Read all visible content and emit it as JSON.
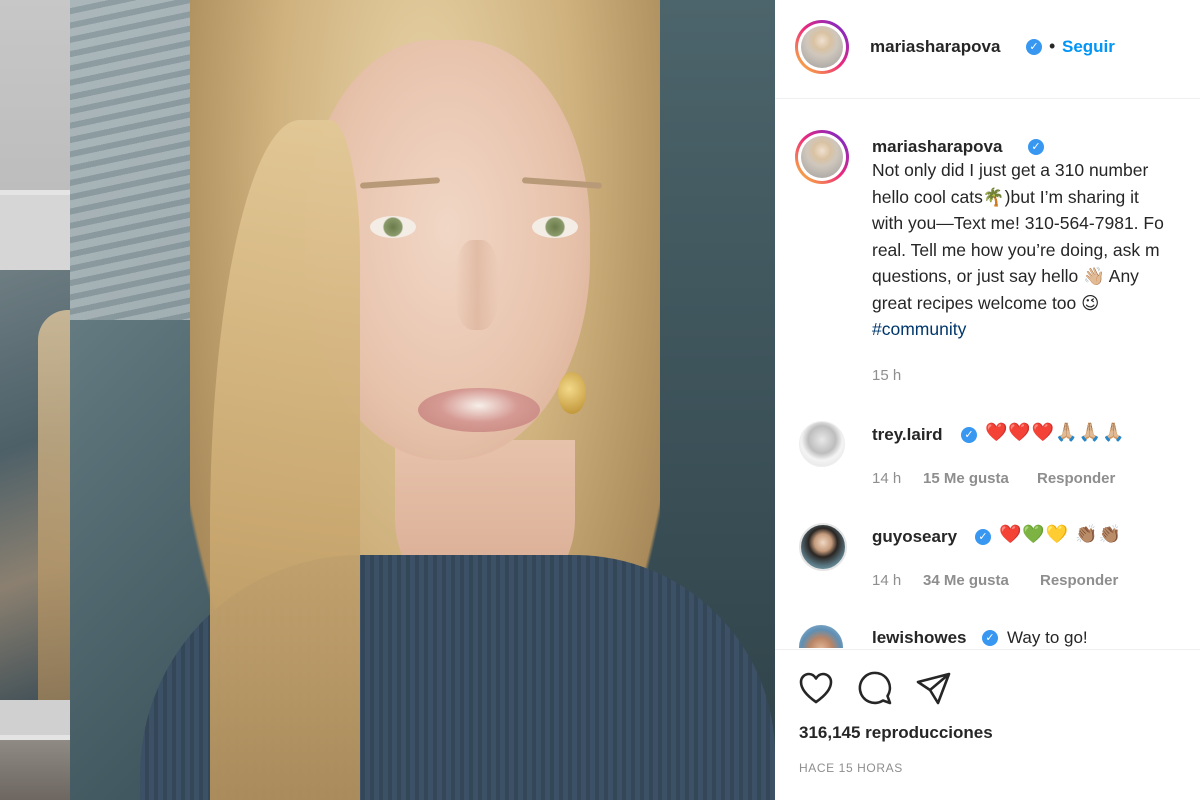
{
  "post": {
    "username": "mariasharapova",
    "follow_label": "Seguir",
    "separator": "•",
    "verified_glyph": "✓"
  },
  "caption": {
    "username": "mariasharapova",
    "line1": "Not only did I just get a 310 number",
    "line2": "hello cool cats🌴)but I’m sharing it",
    "line3": "with you—Text me! 310-564-7981. Fo",
    "line4": "real. Tell me how you’re doing, ask m",
    "line5": "questions, or just say hello 👋🏼 Any",
    "line6": "great recipes welcome too 😉",
    "hashtag": "#community",
    "time": "15 h"
  },
  "comments": [
    {
      "username": "trey.laird",
      "text": "❤️❤️❤️🙏🏼🙏🏼🙏🏼",
      "time": "14 h",
      "likes": "15 Me gusta",
      "reply": "Responder"
    },
    {
      "username": "guyoseary",
      "text": "❤️💚💛 👏🏽👏🏽",
      "time": "14 h",
      "likes": "34 Me gusta",
      "reply": "Responder"
    },
    {
      "username": "lewishowes",
      "text": "Way to go!"
    }
  ],
  "footer": {
    "views": "316,145 reproducciones",
    "posted_ago": "HACE 15 HORAS"
  },
  "icons": [
    "heart-icon",
    "comment-icon",
    "share-icon",
    "verified-badge-icon"
  ],
  "colors": {
    "follow_blue": "#0095f6",
    "verified_blue": "#3897f0",
    "muted_gray": "#8e8e8e",
    "hashtag_blue": "#00376b"
  }
}
